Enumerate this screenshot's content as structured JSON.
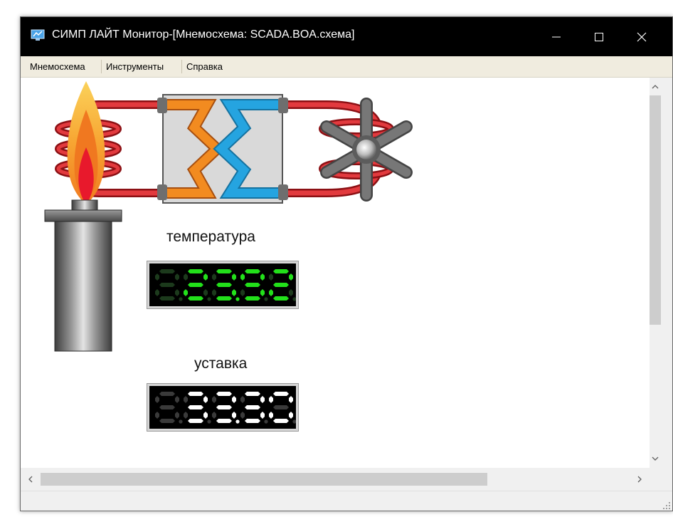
{
  "window": {
    "title": "СИМП ЛАЙТ Монитор-[Мнемосхема: SCADA.BOA.схема]",
    "buttons": [
      "minimize-icon",
      "maximize-icon",
      "close-icon"
    ]
  },
  "menu": {
    "items": [
      {
        "label": "Мнемосхема"
      },
      {
        "label": "Инструменты"
      },
      {
        "label": "Справка"
      }
    ]
  },
  "mnemo": {
    "temperature": {
      "label": "температура",
      "value": "23.92",
      "digit_color": "#22e01a",
      "ghost_color": "#1c3a1c"
    },
    "setpoint": {
      "label": "уставка",
      "value": "33.30",
      "digit_color": "#ffffff",
      "ghost_color": "#3a3a3a"
    },
    "colors": {
      "pipe": "#d7262a",
      "flame_outer": "#f7a532",
      "flame_inner": "#e8192c",
      "hx_orange": "#f28b20",
      "hx_blue": "#25a4e0",
      "fan": "#6e6e6e"
    }
  }
}
